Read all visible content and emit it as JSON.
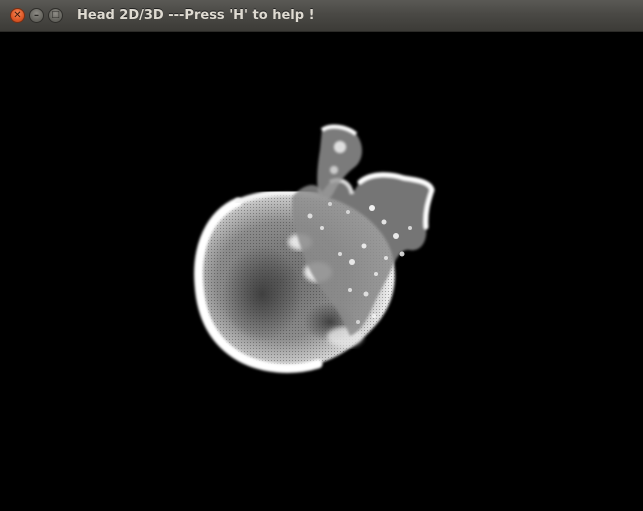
{
  "window": {
    "title": "Head 2D/3D ---Press 'H' to help !"
  },
  "controls": {
    "close_glyph": "✕",
    "minimize_glyph": "–",
    "maximize_glyph": "□"
  },
  "colors": {
    "titlebar": "#3c3b37",
    "close_button": "#e05a28",
    "canvas_background": "#000000",
    "render_highlight": "#ffffff"
  },
  "icons": {
    "close": "close-icon",
    "minimize": "minimize-icon",
    "maximize": "maximize-icon"
  }
}
